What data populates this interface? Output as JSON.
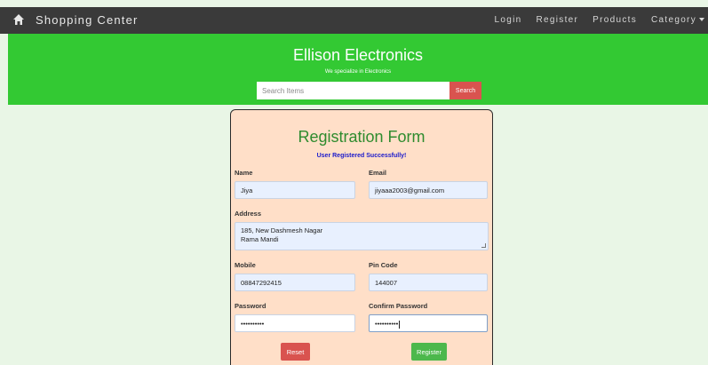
{
  "navbar": {
    "brand": "Shopping Center",
    "links": [
      "Login",
      "Register",
      "Products",
      "Category"
    ]
  },
  "banner": {
    "title": "Ellison Electronics",
    "subtitle": "We specialize in Electronics",
    "search_placeholder": "Search Items",
    "search_button": "Search"
  },
  "form": {
    "title": "Registration Form",
    "success_message": "User Registered Successfully!",
    "name_label": "Name",
    "name_value": "Jiya",
    "email_label": "Email",
    "email_value": "jiyaaa2003@gmail.com",
    "address_label": "Address",
    "address_line1": "185, New Dashmesh Nagar",
    "address_line2": "Rama Mandi",
    "mobile_label": "Mobile",
    "mobile_value": "08847292415",
    "pincode_label": "Pin Code",
    "pincode_value": "144007",
    "password_label": "Password",
    "password_value": "••••••••••",
    "confirm_label": "Confirm Password",
    "confirm_value": "••••••••••",
    "reset_label": "Reset",
    "register_label": "Register"
  },
  "colors": {
    "navbar": "#3a3a3a",
    "banner": "#33c933",
    "page_bg": "#e9f6e6",
    "card_bg": "#ffdfc8",
    "danger": "#d9534f",
    "success": "#4cb84c",
    "title_green": "#2e8b2e",
    "message_blue": "#1a1acc"
  }
}
